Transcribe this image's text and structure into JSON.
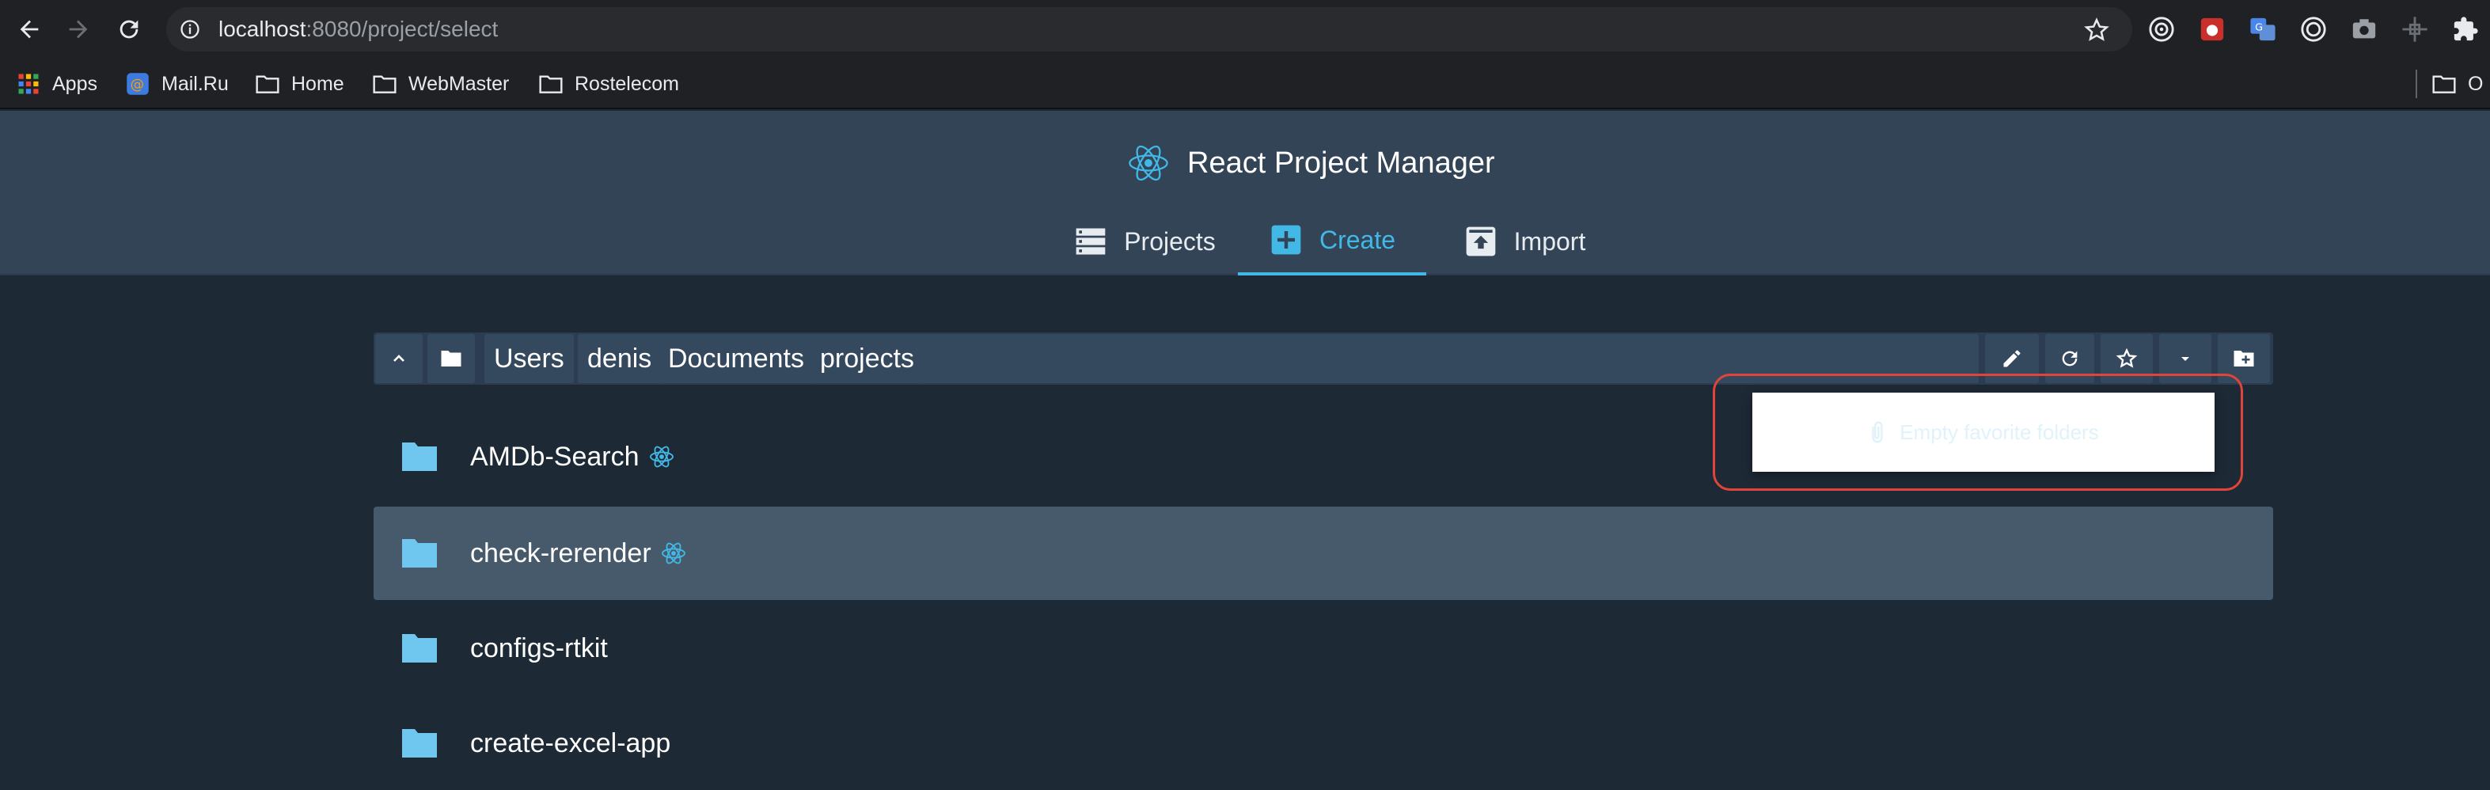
{
  "browser": {
    "url_host": "localhost",
    "url_path": ":8080/project/select",
    "bookmarks": [
      {
        "label": "Apps",
        "icon": "apps-grid-icon"
      },
      {
        "label": "Mail.Ru",
        "icon": "mailru-icon"
      },
      {
        "label": "Home",
        "icon": "folder-icon"
      },
      {
        "label": "WebMaster",
        "icon": "folder-icon"
      },
      {
        "label": "Rostelecom",
        "icon": "folder-icon"
      }
    ],
    "other_bookmarks_label": "O"
  },
  "app": {
    "title": "React Project Manager",
    "tabs": [
      {
        "label": "Projects",
        "icon": "list-icon"
      },
      {
        "label": "Create",
        "icon": "plus-box-icon"
      },
      {
        "label": "Import",
        "icon": "unarchive-icon"
      }
    ],
    "active_tab": "Create"
  },
  "explorer": {
    "breadcrumbs": [
      "Users",
      "denis",
      "Documents",
      "projects"
    ],
    "folders": [
      {
        "name": "AMDb-Search",
        "react": true,
        "selected": false
      },
      {
        "name": "check-rerender",
        "react": true,
        "selected": true
      },
      {
        "name": "configs-rtkit",
        "react": false,
        "selected": false
      },
      {
        "name": "create-excel-app",
        "react": false,
        "selected": false
      }
    ],
    "favorites_empty_text": "Empty favorite folders"
  },
  "colors": {
    "accent": "#42b8e6",
    "header_bg": "#334457",
    "page_bg": "#1d2935",
    "folder_icon": "#6fc6ef",
    "highlight": "#e0443a"
  }
}
